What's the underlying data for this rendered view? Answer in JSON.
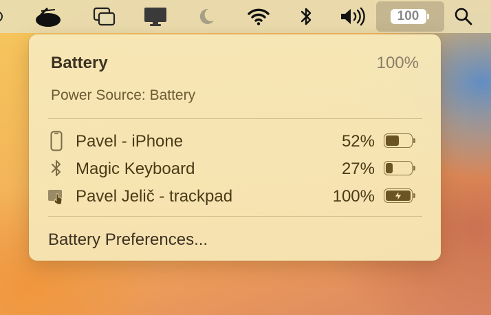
{
  "menubar": {
    "items": [
      {
        "icon": "partial-icon"
      },
      {
        "icon": "ufo-icon"
      },
      {
        "icon": "window-stack-icon"
      },
      {
        "icon": "display-icon"
      },
      {
        "icon": "moon-icon"
      },
      {
        "icon": "wifi-icon"
      },
      {
        "icon": "bluetooth-icon"
      },
      {
        "icon": "volume-icon"
      },
      {
        "icon": "battery-icon"
      },
      {
        "icon": "search-icon"
      }
    ],
    "battery_level": "100"
  },
  "battery_menu": {
    "title": "Battery",
    "percent": "100%",
    "power_source": "Power Source: Battery",
    "devices": [
      {
        "name": "Pavel - iPhone",
        "percent": "52%",
        "level": 0.52,
        "charging": false,
        "icon": "iphone-icon"
      },
      {
        "name": "Magic Keyboard",
        "percent": "27%",
        "level": 0.27,
        "charging": false,
        "icon": "bluetooth-icon"
      },
      {
        "name": "Pavel Jelič - trackpad",
        "percent": "100%",
        "level": 1.0,
        "charging": true,
        "icon": "trackpad-icon"
      }
    ],
    "preferences_label": "Battery Preferences..."
  },
  "colors": {
    "panel_text": "#4a3a16",
    "battery_fill": "#6b5424",
    "menubar_bg": "#e8dcb2"
  }
}
